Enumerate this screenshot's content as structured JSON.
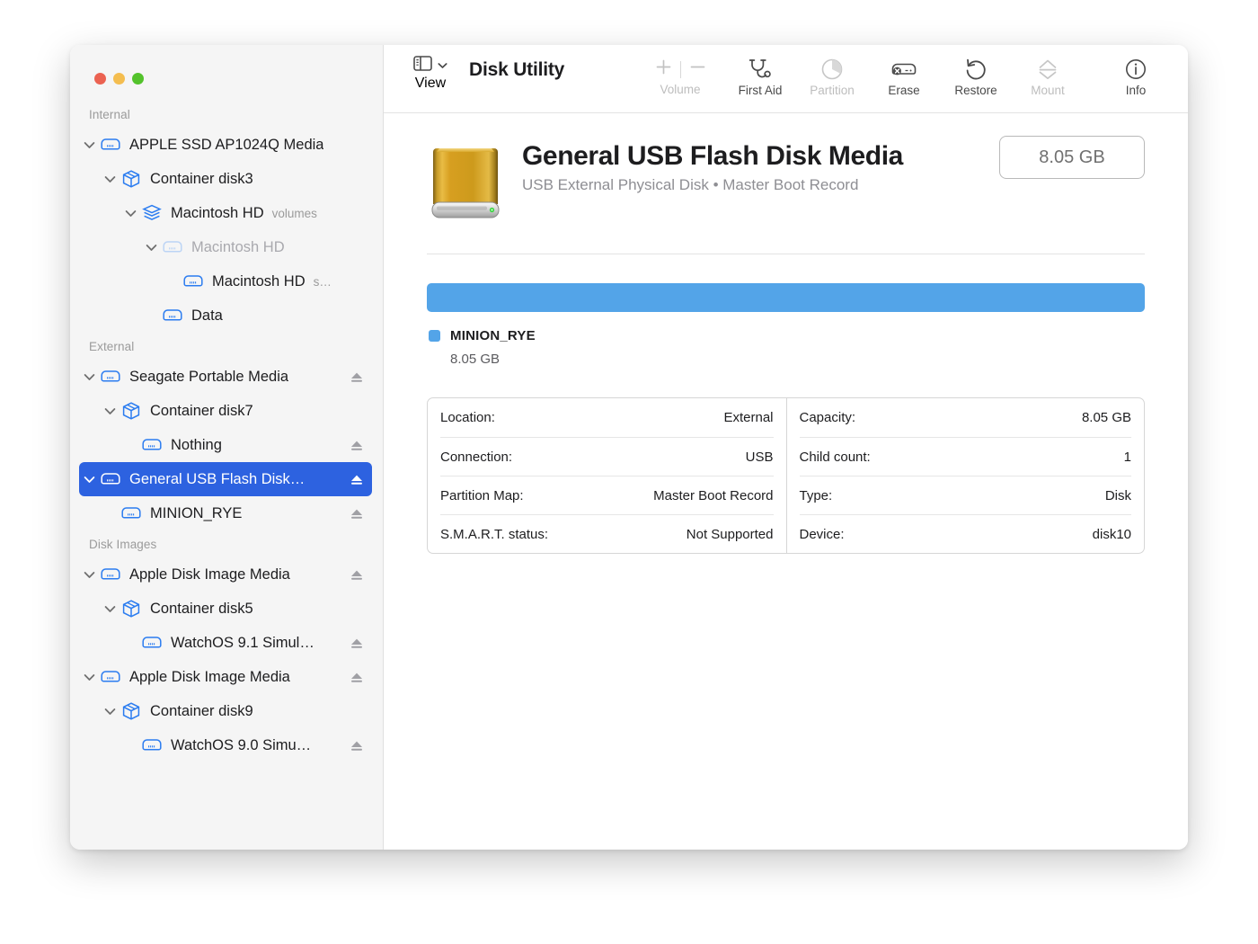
{
  "window": {
    "traffic_lights": [
      {
        "name": "close",
        "color": "#eb6251"
      },
      {
        "name": "minimize",
        "color": "#f4bd4f"
      },
      {
        "name": "maximize",
        "color": "#53c22b"
      }
    ]
  },
  "toolbar": {
    "view_label": "View",
    "view_icon": "sidebar-layout-icon",
    "view_chevron_icon": "chevron-down-icon",
    "app_title": "Disk Utility",
    "volume_group": {
      "label": "Volume",
      "add_icon": "plus-icon",
      "remove_icon": "minus-icon",
      "disabled": true
    },
    "items": [
      {
        "label": "First Aid",
        "icon": "stethoscope-icon",
        "disabled": false
      },
      {
        "label": "Partition",
        "icon": "pie-chart-icon",
        "disabled": true
      },
      {
        "label": "Erase",
        "icon": "erase-disk-icon",
        "disabled": false
      },
      {
        "label": "Restore",
        "icon": "restore-arrow-icon",
        "disabled": false
      },
      {
        "label": "Mount",
        "icon": "eject-mount-icon",
        "disabled": true
      },
      {
        "label": "Info",
        "icon": "info-circle-icon",
        "disabled": false
      }
    ]
  },
  "sidebar": {
    "groups": [
      {
        "title": "Internal",
        "rows": [
          {
            "label": "APPLE SSD AP1024Q Media",
            "sublabel": "",
            "icon": "hard-drive-icon",
            "indent": 1,
            "twisty": "expanded",
            "eject": false,
            "selected": false,
            "dimmed": false
          },
          {
            "label": "Container disk3",
            "sublabel": "",
            "icon": "container-box-icon",
            "indent": 2,
            "twisty": "expanded",
            "eject": false,
            "selected": false,
            "dimmed": false
          },
          {
            "label": "Macintosh HD",
            "sublabel": "volumes",
            "icon": "volume-stack-icon",
            "indent": 3,
            "twisty": "expanded",
            "eject": false,
            "selected": false,
            "dimmed": false
          },
          {
            "label": "Macintosh HD",
            "sublabel": "",
            "icon": "hard-drive-icon-dim",
            "indent": 4,
            "twisty": "expanded",
            "eject": false,
            "selected": false,
            "dimmed": true
          },
          {
            "label": "Macintosh HD",
            "sublabel": "s…",
            "icon": "hard-drive-icon",
            "indent": 5,
            "twisty": "none",
            "eject": false,
            "selected": false,
            "dimmed": false
          },
          {
            "label": "Data",
            "sublabel": "",
            "icon": "hard-drive-icon",
            "indent": 4,
            "twisty": "none",
            "eject": false,
            "selected": false,
            "dimmed": false
          }
        ]
      },
      {
        "title": "External",
        "rows": [
          {
            "label": "Seagate Portable Media",
            "sublabel": "",
            "icon": "hard-drive-icon",
            "indent": 1,
            "twisty": "expanded",
            "eject": true,
            "selected": false,
            "dimmed": false
          },
          {
            "label": "Container disk7",
            "sublabel": "",
            "icon": "container-box-icon",
            "indent": 2,
            "twisty": "expanded",
            "eject": false,
            "selected": false,
            "dimmed": false
          },
          {
            "label": "Nothing",
            "sublabel": "",
            "icon": "hard-drive-icon",
            "indent": 3,
            "twisty": "none",
            "eject": true,
            "selected": false,
            "dimmed": false
          },
          {
            "label": "General USB Flash Disk…",
            "sublabel": "",
            "icon": "hard-drive-icon-white",
            "indent": 1,
            "twisty": "expanded",
            "eject": true,
            "selected": true,
            "dimmed": false
          },
          {
            "label": "MINION_RYE",
            "sublabel": "",
            "icon": "hard-drive-icon",
            "indent": 2,
            "twisty": "none",
            "eject": true,
            "selected": false,
            "dimmed": false
          }
        ]
      },
      {
        "title": "Disk Images",
        "rows": [
          {
            "label": "Apple Disk Image Media",
            "sublabel": "",
            "icon": "hard-drive-icon",
            "indent": 1,
            "twisty": "expanded",
            "eject": true,
            "selected": false,
            "dimmed": false
          },
          {
            "label": "Container disk5",
            "sublabel": "",
            "icon": "container-box-icon",
            "indent": 2,
            "twisty": "expanded",
            "eject": false,
            "selected": false,
            "dimmed": false
          },
          {
            "label": "WatchOS 9.1 Simul…",
            "sublabel": "",
            "icon": "hard-drive-icon",
            "indent": 3,
            "twisty": "none",
            "eject": true,
            "selected": false,
            "dimmed": false
          },
          {
            "label": "Apple Disk Image Media",
            "sublabel": "",
            "icon": "hard-drive-icon",
            "indent": 1,
            "twisty": "expanded",
            "eject": true,
            "selected": false,
            "dimmed": false
          },
          {
            "label": "Container disk9",
            "sublabel": "",
            "icon": "container-box-icon",
            "indent": 2,
            "twisty": "expanded",
            "eject": false,
            "selected": false,
            "dimmed": false
          },
          {
            "label": "WatchOS 9.0 Simu…",
            "sublabel": "",
            "icon": "hard-drive-icon",
            "indent": 3,
            "twisty": "none",
            "eject": true,
            "selected": false,
            "dimmed": false
          }
        ]
      }
    ]
  },
  "detail": {
    "disk_icon": "external-hard-drive-gold-icon",
    "title": "General USB Flash Disk Media",
    "subtitle": "USB External Physical Disk • Master Boot Record",
    "capacity_badge": "8.05 GB",
    "usage": {
      "bar_color": "#53a4e8",
      "fill_percent": 100,
      "legend": [
        {
          "name": "MINION_RYE",
          "size": "8.05 GB",
          "color": "#53a4e8"
        }
      ]
    },
    "info_left": [
      {
        "key": "Location:",
        "value": "External"
      },
      {
        "key": "Connection:",
        "value": "USB"
      },
      {
        "key": "Partition Map:",
        "value": "Master Boot Record"
      },
      {
        "key": "S.M.A.R.T. status:",
        "value": "Not Supported"
      }
    ],
    "info_right": [
      {
        "key": "Capacity:",
        "value": "8.05 GB"
      },
      {
        "key": "Child count:",
        "value": "1"
      },
      {
        "key": "Type:",
        "value": "Disk"
      },
      {
        "key": "Device:",
        "value": "disk10"
      }
    ]
  },
  "annotation": {
    "cursor_icon": "red-arrow-pointer",
    "cursor_color": "#f50d0d",
    "points_at": "Erase"
  }
}
